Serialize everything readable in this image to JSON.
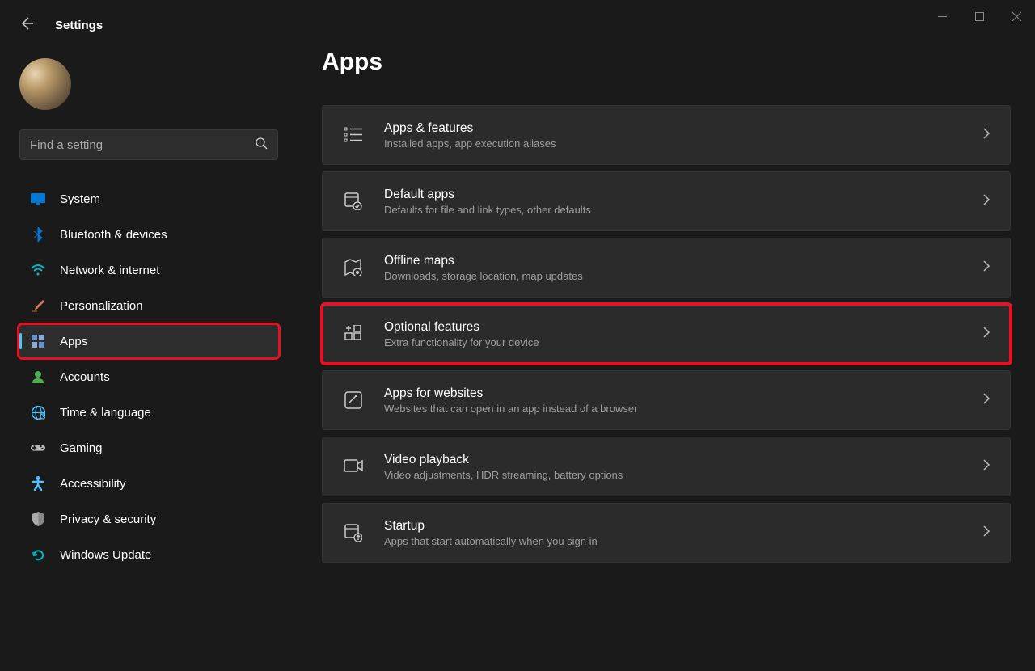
{
  "header": {
    "title": "Settings"
  },
  "search": {
    "placeholder": "Find a setting"
  },
  "page": {
    "title": "Apps"
  },
  "sidebar": {
    "items": [
      {
        "label": "System",
        "icon": "display-icon",
        "color": "#0078d4"
      },
      {
        "label": "Bluetooth & devices",
        "icon": "bluetooth-icon",
        "color": "#0078d4"
      },
      {
        "label": "Network & internet",
        "icon": "wifi-icon",
        "color": "#00b7c3"
      },
      {
        "label": "Personalization",
        "icon": "brush-icon",
        "color": "#d87a5a"
      },
      {
        "label": "Apps",
        "icon": "apps-icon",
        "color": "#6b8fc7",
        "active": true,
        "highlighted": true
      },
      {
        "label": "Accounts",
        "icon": "person-icon",
        "color": "#4caf50"
      },
      {
        "label": "Time & language",
        "icon": "globe-icon",
        "color": "#4fc3f7"
      },
      {
        "label": "Gaming",
        "icon": "gamepad-icon",
        "color": "#888888"
      },
      {
        "label": "Accessibility",
        "icon": "accessibility-icon",
        "color": "#4cc2ff"
      },
      {
        "label": "Privacy & security",
        "icon": "shield-icon",
        "color": "#888888"
      },
      {
        "label": "Windows Update",
        "icon": "update-icon",
        "color": "#00b7c3"
      }
    ]
  },
  "cards": [
    {
      "title": "Apps & features",
      "sub": "Installed apps, app execution aliases",
      "icon": "list-icon"
    },
    {
      "title": "Default apps",
      "sub": "Defaults for file and link types, other defaults",
      "icon": "default-apps-icon"
    },
    {
      "title": "Offline maps",
      "sub": "Downloads, storage location, map updates",
      "icon": "map-icon"
    },
    {
      "title": "Optional features",
      "sub": "Extra functionality for your device",
      "icon": "features-icon",
      "highlighted": true
    },
    {
      "title": "Apps for websites",
      "sub": "Websites that can open in an app instead of a browser",
      "icon": "websites-icon"
    },
    {
      "title": "Video playback",
      "sub": "Video adjustments, HDR streaming, battery options",
      "icon": "video-icon"
    },
    {
      "title": "Startup",
      "sub": "Apps that start automatically when you sign in",
      "icon": "startup-icon"
    }
  ]
}
